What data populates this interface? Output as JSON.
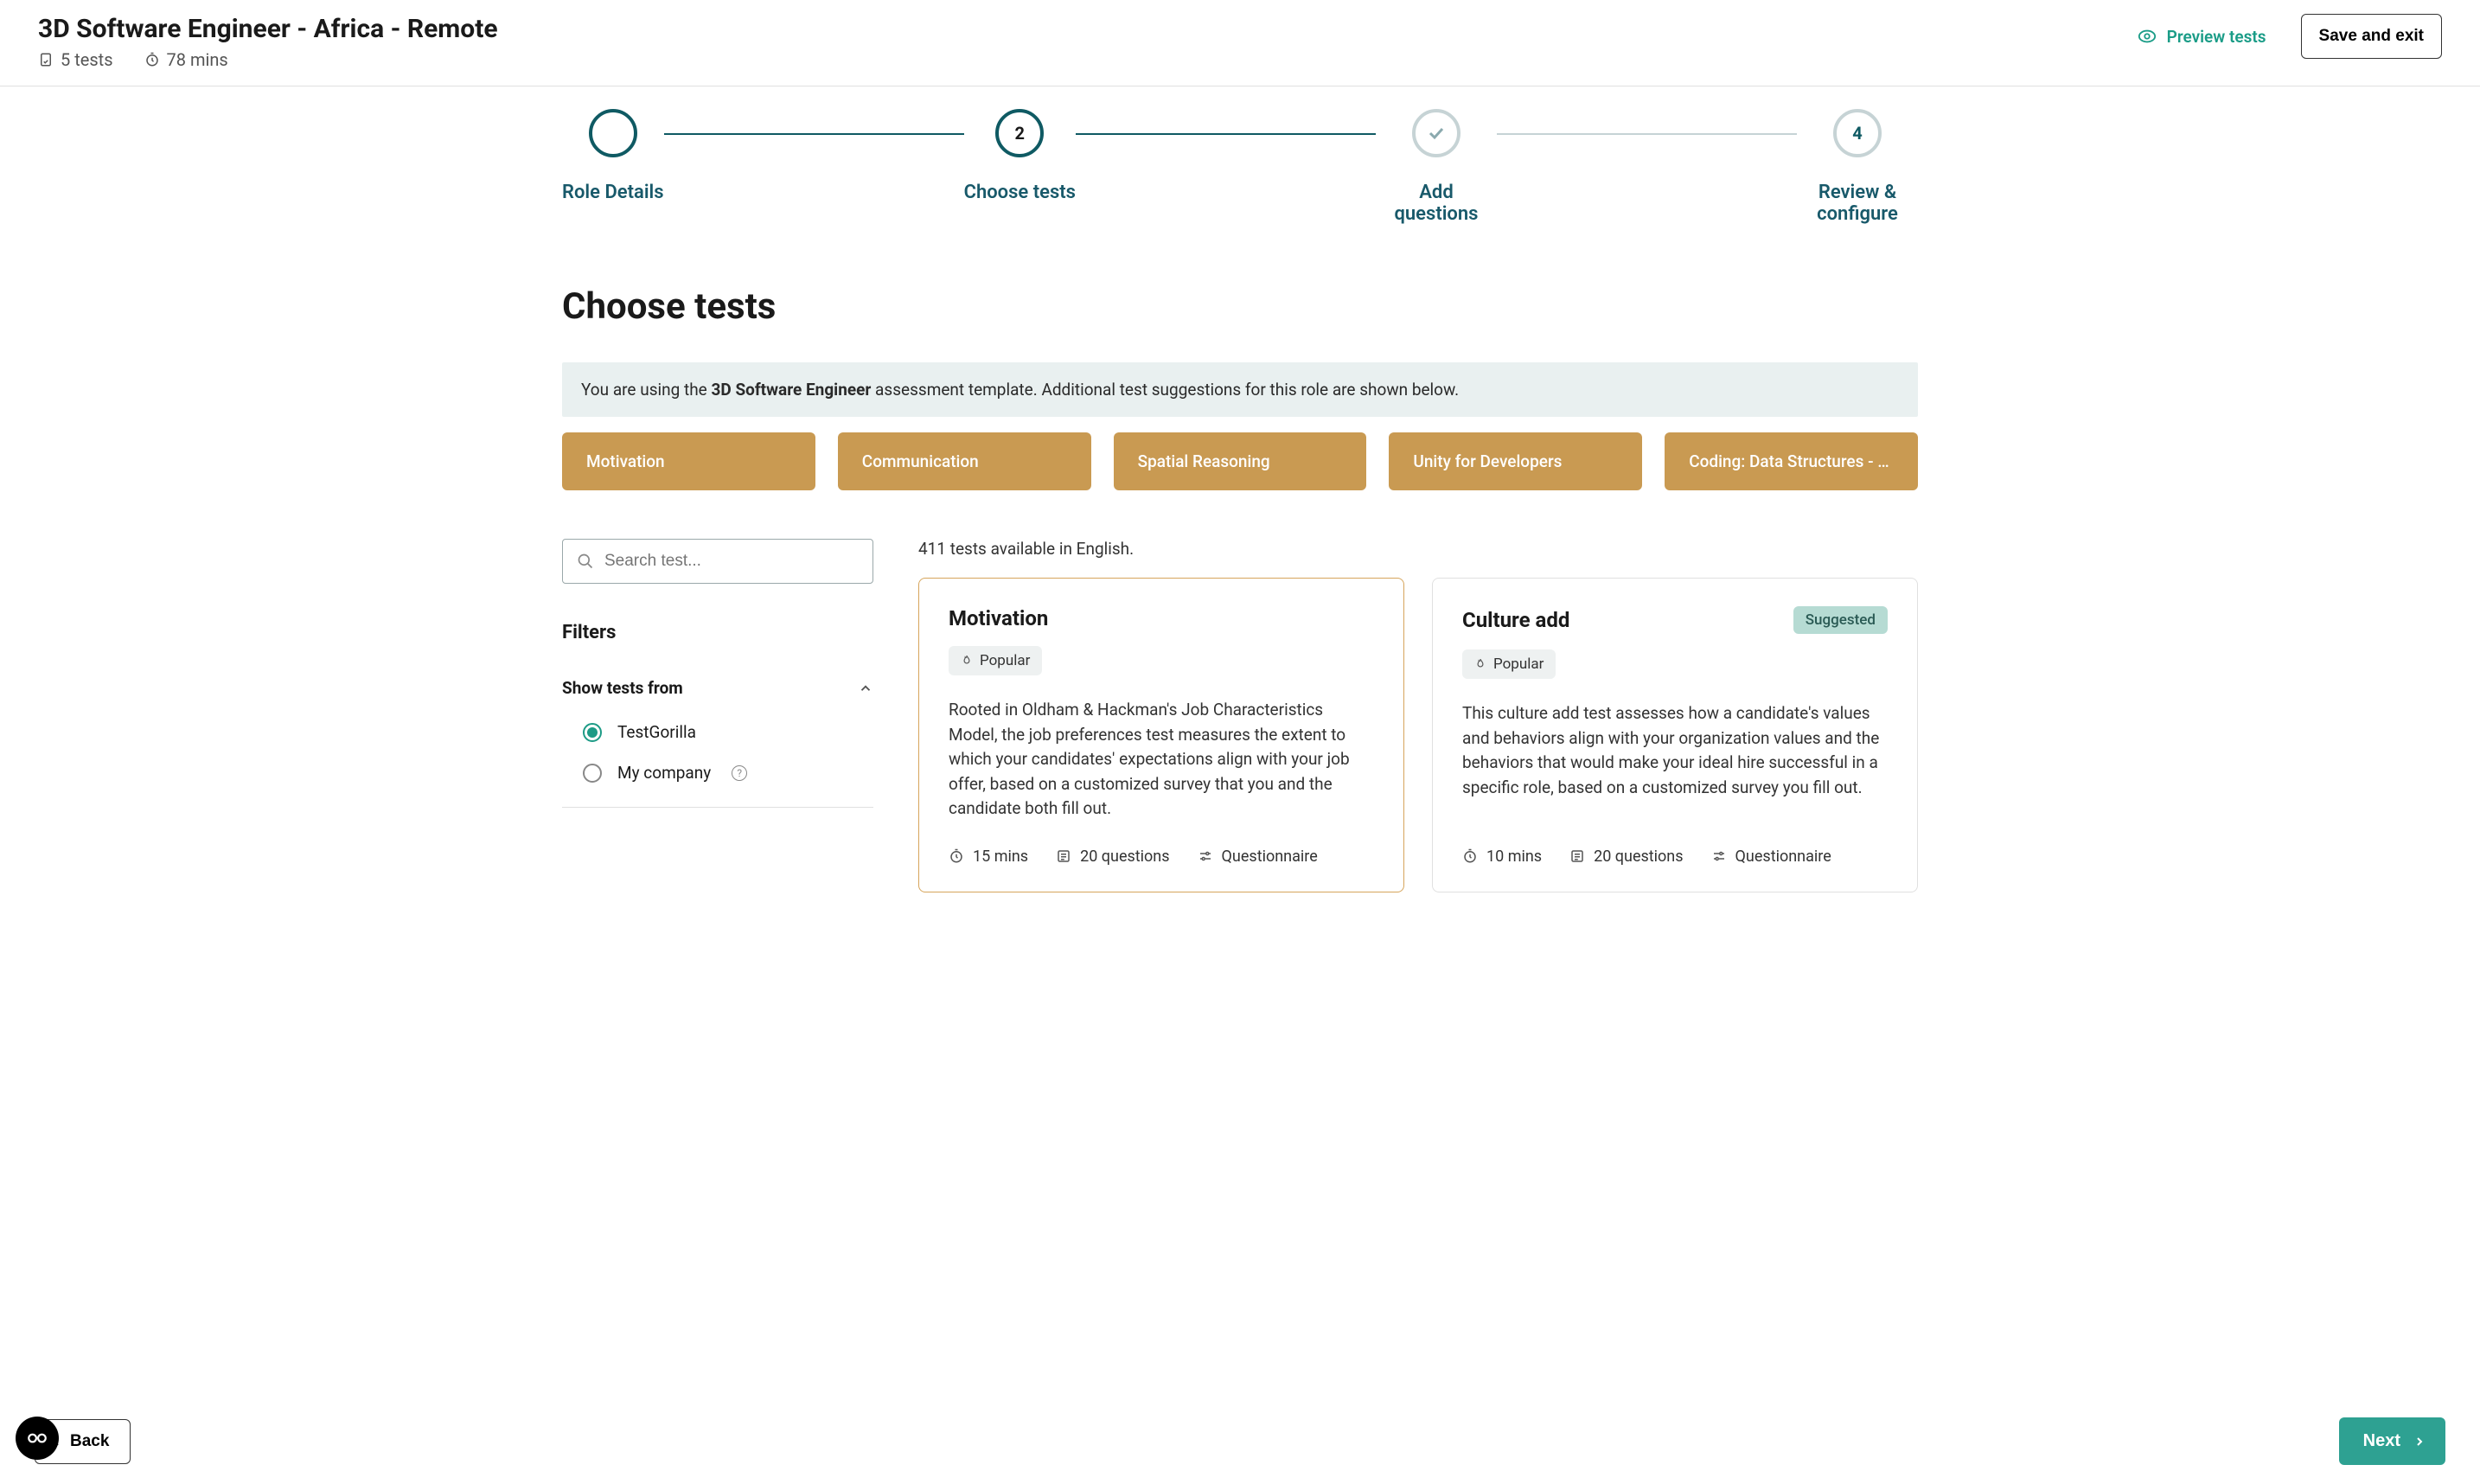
{
  "header": {
    "title": "3D Software Engineer - Africa - Remote",
    "tests_count": "5 tests",
    "duration": "78 mins",
    "preview_label": "Preview tests",
    "save_exit_label": "Save and exit"
  },
  "stepper": {
    "steps": [
      {
        "label": "Role Details"
      },
      {
        "label": "Choose tests",
        "num": "2"
      },
      {
        "label": "Add questions"
      },
      {
        "label": "Review & configure",
        "num": "4"
      }
    ]
  },
  "page": {
    "heading": "Choose tests",
    "banner_prefix": "You are using the ",
    "banner_bold": "3D Software Engineer",
    "banner_suffix": " assessment template. Additional test suggestions for this role are shown below."
  },
  "selected_tests": [
    "Motivation",
    "Communication",
    "Spatial Reasoning",
    "Unity for Developers",
    "Coding: Data Structures - Ha..."
  ],
  "sidebar": {
    "search_placeholder": "Search test...",
    "filters_heading": "Filters",
    "group1_title": "Show tests from",
    "options": [
      {
        "label": "TestGorilla",
        "selected": true
      },
      {
        "label": "My company",
        "selected": false,
        "help": true
      }
    ]
  },
  "results": {
    "meta": "411 tests available in English.",
    "cards": [
      {
        "title": "Motivation",
        "popular": "Popular",
        "desc": "Rooted in Oldham & Hackman's Job Characteristics Model, the job preferences test measures the extent to which your candidates' expectations align with your job offer, based on a customized survey that you and the candidate both fill out.",
        "duration": "15 mins",
        "questions": "20 questions",
        "type": "Questionnaire",
        "highlight": true,
        "suggested": false
      },
      {
        "title": "Culture add",
        "popular": "Popular",
        "desc": "This culture add test assesses how a candidate's values and behaviors align with your organization values and the behaviors that would make your ideal hire successful in a specific role, based on a customized survey you fill out.",
        "duration": "10 mins",
        "questions": "20 questions",
        "type": "Questionnaire",
        "highlight": false,
        "suggested": true,
        "suggested_label": "Suggested"
      }
    ]
  },
  "footer": {
    "back_label": "Back",
    "next_label": "Next"
  }
}
